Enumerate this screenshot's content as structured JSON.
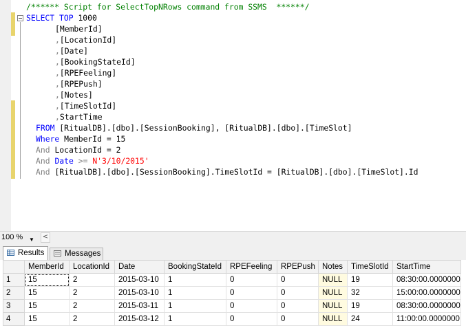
{
  "editor": {
    "comment": "/****** Script for SelectTopNRows command from SSMS  ******/",
    "lines": {
      "select_kw": "SELECT",
      "top_kw": "TOP",
      "top_n": "1000",
      "col1": "[MemberId]",
      "col2": "[LocationId]",
      "col3": "[Date]",
      "col4": "[BookingStateId]",
      "col5": "[RPEFeeling]",
      "col6": "[RPEPush]",
      "col7": "[Notes]",
      "col8": "[TimeSlotId]",
      "col9": "StartTime",
      "comma": ",",
      "from_kw": "FROM",
      "from_body": "[RitualDB].[dbo].[SessionBooking], [RitualDB].[dbo].[TimeSlot]",
      "where_kw": "Where",
      "where_body": "MemberId = 15",
      "and_kw": "And",
      "and1_body": "LocationId = 2",
      "date_kw": "Date",
      "date_op": ">=",
      "date_val": "N'3/10/2015'",
      "and4_body": "[RitualDB].[dbo].[SessionBooking].TimeSlotId = [RitualDB].[dbo].[TimeSlot].Id"
    }
  },
  "zoom": {
    "value": "100 %",
    "scroll_left": "<"
  },
  "tabs": {
    "results": "Results",
    "messages": "Messages"
  },
  "grid": {
    "columns": [
      "MemberId",
      "LocationId",
      "Date",
      "BookingStateId",
      "RPEFeeling",
      "RPEPush",
      "Notes",
      "TimeSlotId",
      "StartTime"
    ],
    "rows": [
      [
        "1",
        "15",
        "2",
        "2015-03-10",
        "1",
        "0",
        "0",
        "NULL",
        "19",
        "08:30:00.0000000"
      ],
      [
        "2",
        "15",
        "2",
        "2015-03-10",
        "1",
        "0",
        "0",
        "NULL",
        "32",
        "15:00:00.0000000"
      ],
      [
        "3",
        "15",
        "2",
        "2015-03-11",
        "1",
        "0",
        "0",
        "NULL",
        "19",
        "08:30:00.0000000"
      ],
      [
        "4",
        "15",
        "2",
        "2015-03-12",
        "1",
        "0",
        "0",
        "NULL",
        "24",
        "11:00:00.0000000"
      ]
    ]
  },
  "colors": {
    "keyword": "#0000ff",
    "string": "#ff0000",
    "comment": "#008000",
    "operator": "#808080",
    "null_cell": "#fffbe0"
  }
}
